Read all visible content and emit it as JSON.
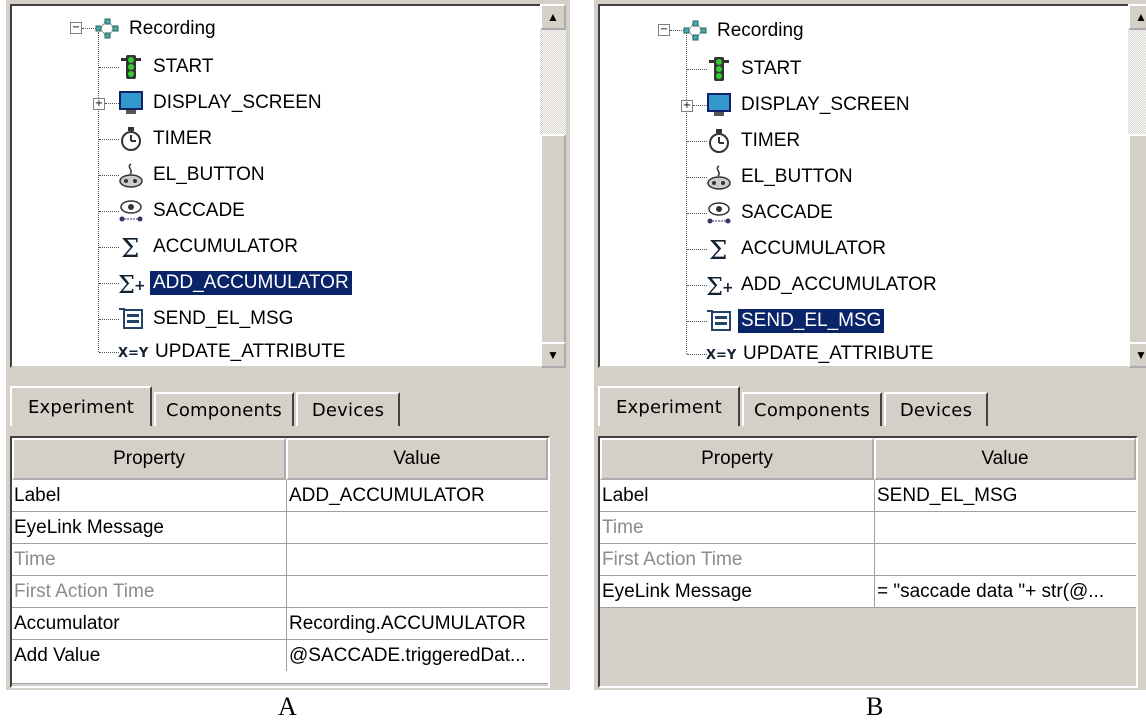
{
  "panels": [
    {
      "caption": "A",
      "tree": {
        "root": "Recording",
        "items": [
          "START",
          "DISPLAY_SCREEN",
          "TIMER",
          "EL_BUTTON",
          "SACCADE",
          "ACCUMULATOR",
          "ADD_ACCUMULATOR",
          "SEND_EL_MSG",
          "UPDATE_ATTRIBUTE"
        ],
        "selected": "ADD_ACCUMULATOR"
      },
      "tabs": [
        "Experiment",
        "Components",
        "Devices"
      ],
      "active_tab": "Experiment",
      "properties": {
        "headers": [
          "Property",
          "Value"
        ],
        "rows": [
          [
            "Label",
            "ADD_ACCUMULATOR"
          ],
          [
            "EyeLink Message",
            ""
          ],
          [
            "Time",
            ""
          ],
          [
            "First Action Time",
            ""
          ],
          [
            "Accumulator",
            "Recording.ACCUMULATOR"
          ],
          [
            "Add Value",
            "@SACCADE.triggeredDat..."
          ]
        ]
      }
    },
    {
      "caption": "B",
      "tree": {
        "root": "Recording",
        "items": [
          "START",
          "DISPLAY_SCREEN",
          "TIMER",
          "EL_BUTTON",
          "SACCADE",
          "ACCUMULATOR",
          "ADD_ACCUMULATOR",
          "SEND_EL_MSG",
          "UPDATE_ATTRIBUTE"
        ],
        "selected": "SEND_EL_MSG"
      },
      "tabs": [
        "Experiment",
        "Components",
        "Devices"
      ],
      "active_tab": "Experiment",
      "properties": {
        "headers": [
          "Property",
          "Value"
        ],
        "rows": [
          [
            "Label",
            "SEND_EL_MSG"
          ],
          [
            "Time",
            ""
          ],
          [
            "First Action Time",
            ""
          ],
          [
            "EyeLink Message",
            "= \"saccade data \"+ str(@..."
          ]
        ]
      }
    }
  ],
  "icons": [
    "traffic-light-icon",
    "display-screen-icon",
    "timer-icon",
    "el-button-icon",
    "saccade-icon",
    "sigma-icon",
    "sigma-plus-icon",
    "send-message-icon",
    "update-attribute-icon"
  ],
  "colors": {
    "selection": "#0a246a",
    "chrome": "#d4d0c8",
    "disabled_text": "#8c8c8c"
  }
}
